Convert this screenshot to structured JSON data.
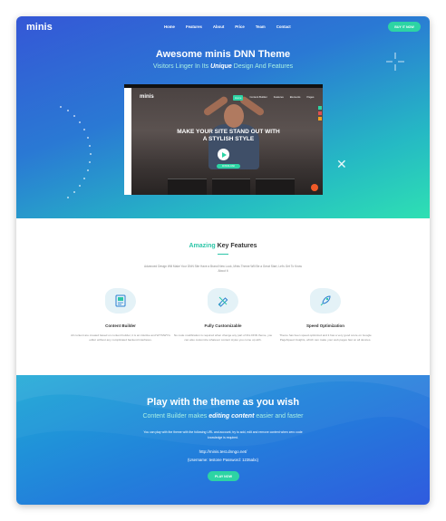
{
  "header": {
    "logo": "minis",
    "nav": [
      "Home",
      "Features",
      "About",
      "Price",
      "Team",
      "Contact"
    ],
    "cta": "BUY IT NOW"
  },
  "hero": {
    "title": "Awesome minis DNN Theme",
    "subtitle_prefix": "Visitors Linger In Its ",
    "subtitle_emphasis": "Unique",
    "subtitle_suffix": " Design And Features"
  },
  "video": {
    "logo": "minis",
    "nav": [
      "Home",
      "Content Builder",
      "Features",
      "Elements",
      "Pages"
    ],
    "headline_line1": "MAKE YOUR SITE STAND OUT WITH",
    "headline_line2": "A STYLISH STYLE",
    "cta": "DOWNLOAD"
  },
  "features": {
    "title_highlight": "Amazing",
    "title_rest": " Key Features",
    "intro": "Advanced Design Will Make Your DNN Site Have a Brand New Look, Minis Theme Will Be a Great Start, Let's Get To Know About It",
    "items": [
      {
        "title": "Content Builder",
        "icon": "content-builder-icon",
        "desc": "All content are created based on content builder, it is an intuitive and WYSIWYG editor without any complicated backend interfaces."
      },
      {
        "title": "Fully Customizable",
        "icon": "pencil-ruler-icon",
        "desc": "No code modification is required when change any part of this DNN theme, you can also customize whatever content styles you come up with."
      },
      {
        "title": "Speed Optimization",
        "icon": "rocket-icon",
        "desc": "Theme has been speed optimized and it has a very good score on Google PageSpeed Insights, which can make your web pages fast on all devices."
      }
    ]
  },
  "play": {
    "title": "Play with the theme as you wish",
    "subtitle_prefix": "Content Builder makes ",
    "subtitle_emphasis": "editing content",
    "subtitle_suffix": " easier and faster",
    "desc": "You can play with the theme with the following URL and account, try to add, edit and remove content when zero code knowledge is required.",
    "url": "http://minis.test.dnngo.net/",
    "credentials": "(Username: testone  Password: 1235abc)",
    "cta": "PLAY NOW"
  },
  "colors": {
    "accent": "#2dd4a4",
    "hero_start": "#3557d6",
    "hero_end": "#2ee0b3",
    "play_start": "#1ea9d6",
    "play_end": "#2f5bde"
  }
}
